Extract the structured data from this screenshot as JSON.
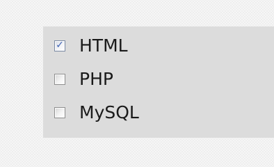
{
  "options": [
    {
      "label": "HTML",
      "checked": true
    },
    {
      "label": "PHP",
      "checked": false
    },
    {
      "label": "MySQL",
      "checked": false
    }
  ],
  "check_glyph": "✓",
  "colors": {
    "panel": "#dcdcdc",
    "background": "#f6f6f6",
    "check": "#3f63b5",
    "text": "#1a1a1a"
  }
}
